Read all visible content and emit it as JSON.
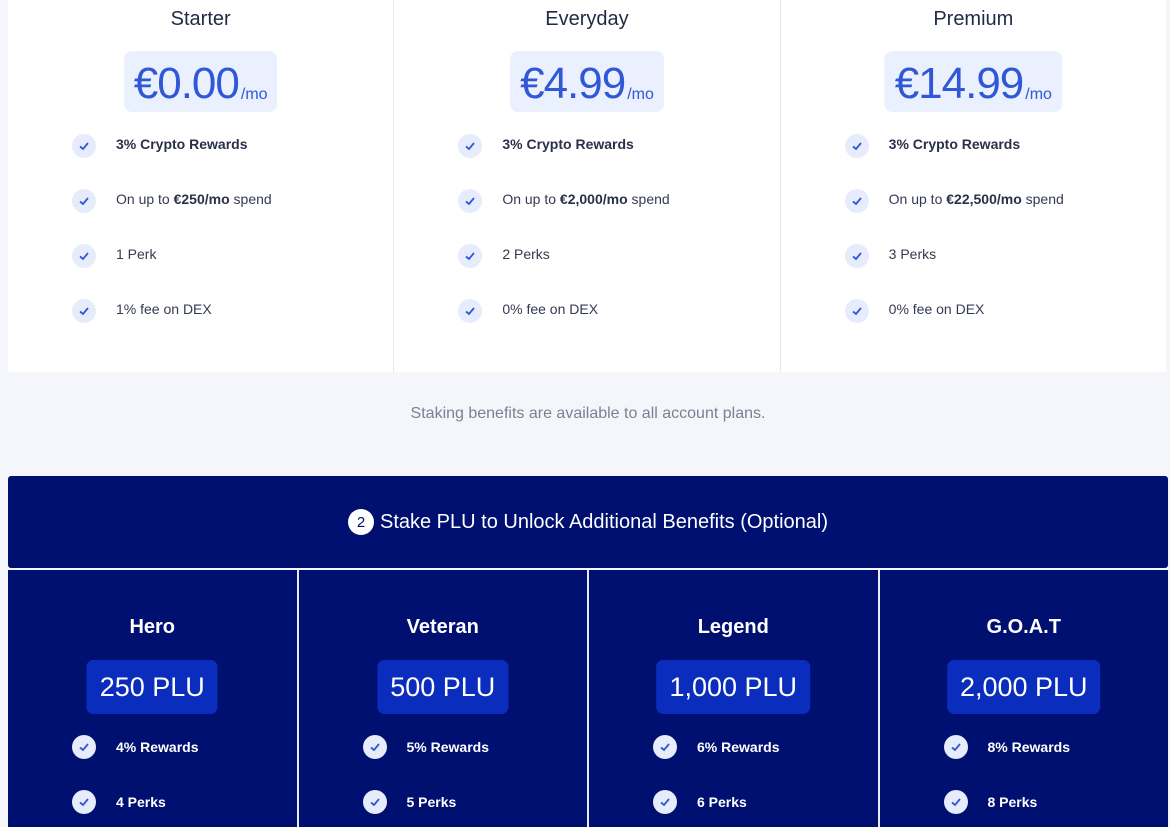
{
  "plans": [
    {
      "name": "Starter",
      "price": "€0.00",
      "unit": "/mo",
      "features": [
        {
          "pre": "",
          "bold": "3% Crypto Rewards",
          "post": ""
        },
        {
          "pre": "On up to ",
          "bold": "€250/mo",
          "post": " spend"
        },
        {
          "pre": "1 Perk",
          "bold": "",
          "post": ""
        },
        {
          "pre": "1% fee on DEX",
          "bold": "",
          "post": ""
        }
      ]
    },
    {
      "name": "Everyday",
      "price": "€4.99",
      "unit": "/mo",
      "features": [
        {
          "pre": "",
          "bold": "3% Crypto Rewards",
          "post": ""
        },
        {
          "pre": "On up to ",
          "bold": "€2,000/mo",
          "post": " spend"
        },
        {
          "pre": "2 Perks",
          "bold": "",
          "post": ""
        },
        {
          "pre": "0% fee on DEX",
          "bold": "",
          "post": ""
        }
      ]
    },
    {
      "name": "Premium",
      "price": "€14.99",
      "unit": "/mo",
      "features": [
        {
          "pre": "",
          "bold": "3% Crypto Rewards",
          "post": ""
        },
        {
          "pre": "On up to ",
          "bold": "€22,500/mo",
          "post": " spend"
        },
        {
          "pre": "3 Perks",
          "bold": "",
          "post": ""
        },
        {
          "pre": "0% fee on DEX",
          "bold": "",
          "post": ""
        }
      ]
    }
  ],
  "note": "Staking benefits are available to all account plans.",
  "stake_banner": {
    "step": "2",
    "title": "Stake PLU to Unlock Additional Benefits (Optional)"
  },
  "tiers": [
    {
      "name": "Hero",
      "amount": "250 PLU",
      "features": [
        "4% Rewards",
        "4 Perks"
      ]
    },
    {
      "name": "Veteran",
      "amount": "500 PLU",
      "features": [
        "5% Rewards",
        "5 Perks"
      ]
    },
    {
      "name": "Legend",
      "amount": "1,000 PLU",
      "features": [
        "6% Rewards",
        "6 Perks"
      ]
    },
    {
      "name": "G.O.A.T",
      "amount": "2,000 PLU",
      "features": [
        "8% Rewards",
        "8 Perks"
      ]
    }
  ],
  "icons": {
    "check": "check-icon"
  },
  "colors": {
    "accent": "#2f57d6",
    "navy": "#001071",
    "chip": "#0b2dbd"
  }
}
